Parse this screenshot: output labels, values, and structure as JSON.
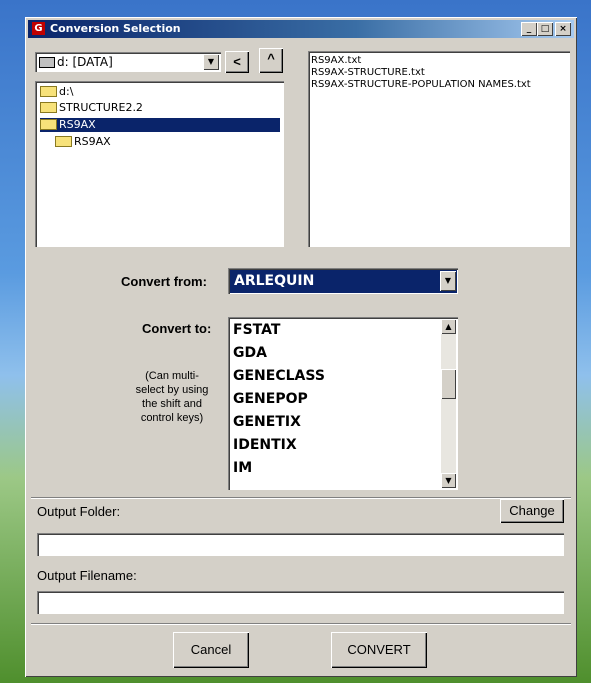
{
  "window": {
    "title": "Conversion Selection",
    "minimize": "_",
    "maximize": "□",
    "close": "×"
  },
  "drive": {
    "label": "d: [DATA]"
  },
  "nav": {
    "back": "<",
    "up": "^"
  },
  "folders": [
    {
      "label": "d:\\"
    },
    {
      "label": "STRUCTURE2.2"
    },
    {
      "label": "RS9AX"
    },
    {
      "label": "RS9AX"
    }
  ],
  "files": [
    {
      "label": "RS9AX.txt"
    },
    {
      "label": "RS9AX-STRUCTURE.txt"
    },
    {
      "label": "RS9AX-STRUCTURE-POPULATION NAMES.txt"
    }
  ],
  "convert_from": {
    "label": "Convert from:",
    "value": "ARLEQUIN"
  },
  "convert_to": {
    "label": "Convert to:",
    "hint": [
      "(Can multi-",
      "select by using",
      "the shift and",
      "control keys)"
    ],
    "options": [
      "FSTAT",
      "GDA",
      "GENECLASS",
      "GENEPOP",
      "GENETIX",
      "IDENTIX",
      "IM"
    ]
  },
  "output_folder": {
    "label": "Output Folder:",
    "change_label": "Change",
    "value": ""
  },
  "output_filename": {
    "label": "Output Filename:",
    "value": ""
  },
  "buttons": {
    "cancel": "Cancel",
    "convert": "CONVERT"
  },
  "icons": [
    "app-icon",
    "drive-icon",
    "folder-icon",
    "chevron-down-icon",
    "back-arrow-icon",
    "up-arrow-icon"
  ]
}
